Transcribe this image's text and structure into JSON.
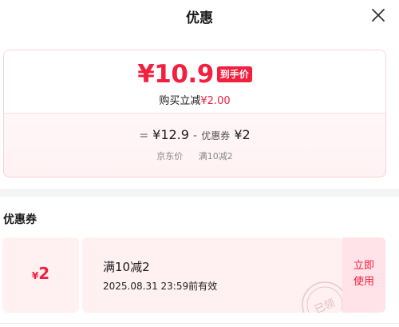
{
  "header": {
    "title": "优惠",
    "close_icon": "close-icon"
  },
  "summary": {
    "final_price": "¥10.9",
    "final_badge": "到手价",
    "reduce_label": "购买立减",
    "reduce_amount": "¥2.00",
    "formula": {
      "equals": "=",
      "jd_price": "¥12.9",
      "minus": "-",
      "coupon_label": "优惠券",
      "coupon_amount": "¥2"
    },
    "labels": {
      "jd_price_label": "京东价",
      "coupon_rule_label": "满10减2"
    }
  },
  "coupon_section": {
    "title": "优惠券",
    "coupons": [
      {
        "currency": "¥",
        "amount": "2",
        "condition": "满10减2",
        "expiry": "2025.08.31 23:59前有效",
        "stamp_text": "已领",
        "action_line1": "立即",
        "action_line2": "使用"
      }
    ]
  },
  "colors": {
    "accent": "#f2203e",
    "coupon_bg": "#fff0f2",
    "coupon_action_bg": "#ffe3e8"
  }
}
